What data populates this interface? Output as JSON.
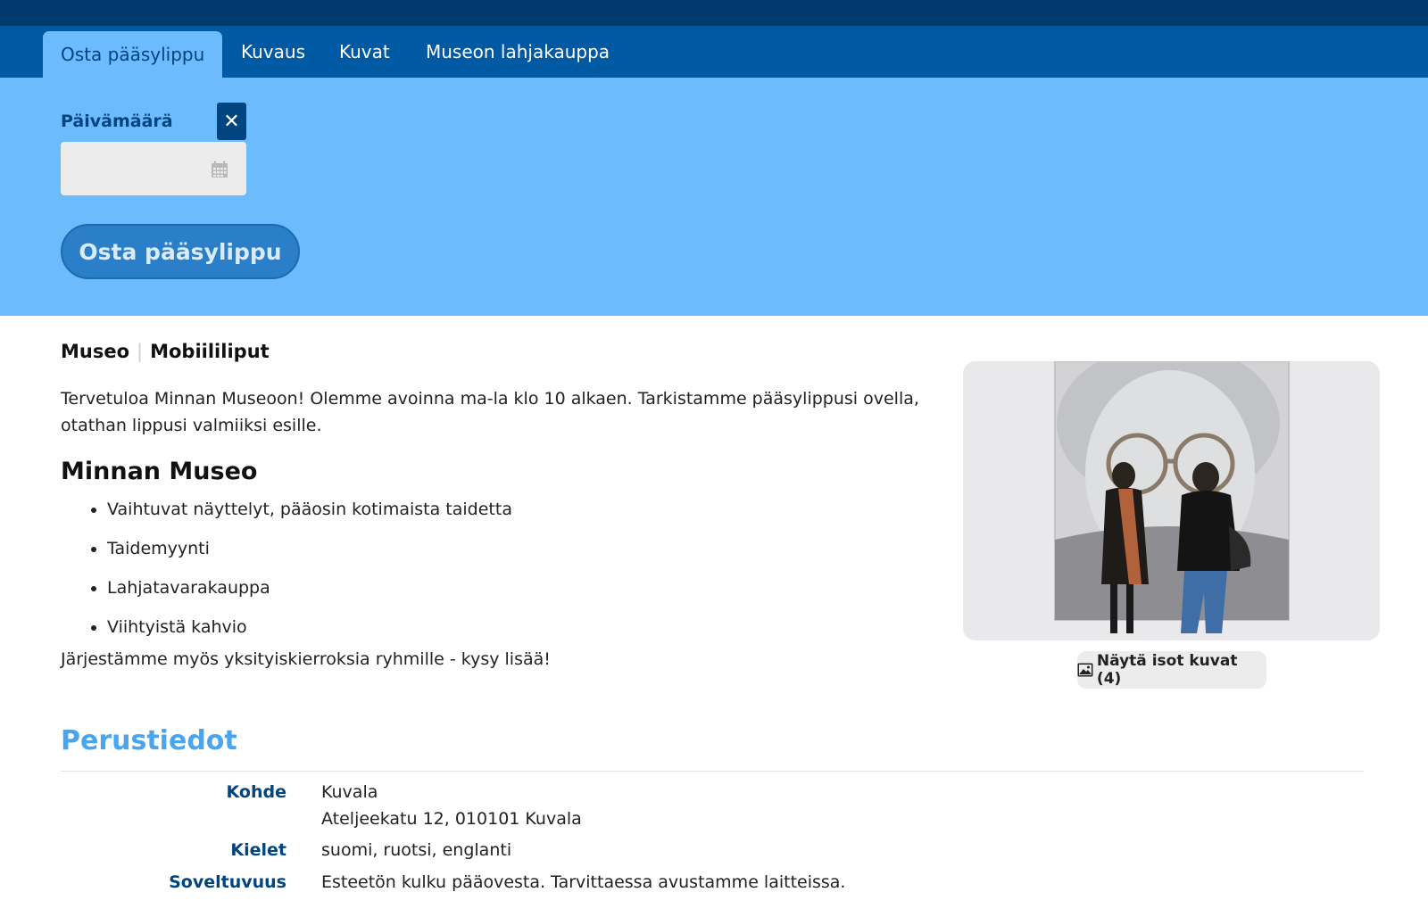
{
  "tabs": [
    {
      "label": "Osta pääsylippu"
    },
    {
      "label": "Kuvaus"
    },
    {
      "label": "Kuvat"
    },
    {
      "label": "Museon lahjakauppa"
    }
  ],
  "booking": {
    "date_label": "Päivämäärä",
    "date_value": "",
    "clear_icon": "close-icon",
    "calendar_icon": "calendar-icon",
    "buy_label": "Osta pääsylippu"
  },
  "breadcrumb": {
    "first": "Museo",
    "second": "Mobiililiput"
  },
  "intro": "Tervetuloa Minnan Museoon! Olemme avoinna ma-la klo 10 alkaen. Tarkistamme pääsylippusi ovella, otathan lippusi valmiiksi esille.",
  "museum": {
    "title": "Minnan Museo",
    "features": [
      "Vaihtuvat näyttelyt, pääosin kotimaista taidetta",
      "Taidemyynti",
      "Lahjatavarakauppa",
      "Viihtyistä kahvio"
    ],
    "tours": "Järjestämme myös yksityiskierroksia ryhmille - kysy lisää!"
  },
  "gallery": {
    "button_label": "Näytä isot kuvat (4)",
    "button_icon": "image-icon"
  },
  "basic_info": {
    "title": "Perustiedot",
    "rows": [
      {
        "label": "Kohde",
        "value": "Kuvala",
        "value2": "Ateljeekatu 12, 010101 Kuvala"
      },
      {
        "label": "Kielet",
        "value": "suomi, ruotsi, englanti"
      },
      {
        "label": "Soveltuvuus",
        "value": "Esteetön kulku pääovesta. Tarvittaessa avustamme laitteissa."
      }
    ]
  },
  "colors": {
    "topbar": "#003a6e",
    "tabbar": "#0059a3",
    "hero": "#6bbbfd",
    "accent_dark": "#00457f",
    "button": "#2b7ec8",
    "heading_blue": "#4aa5ef"
  }
}
